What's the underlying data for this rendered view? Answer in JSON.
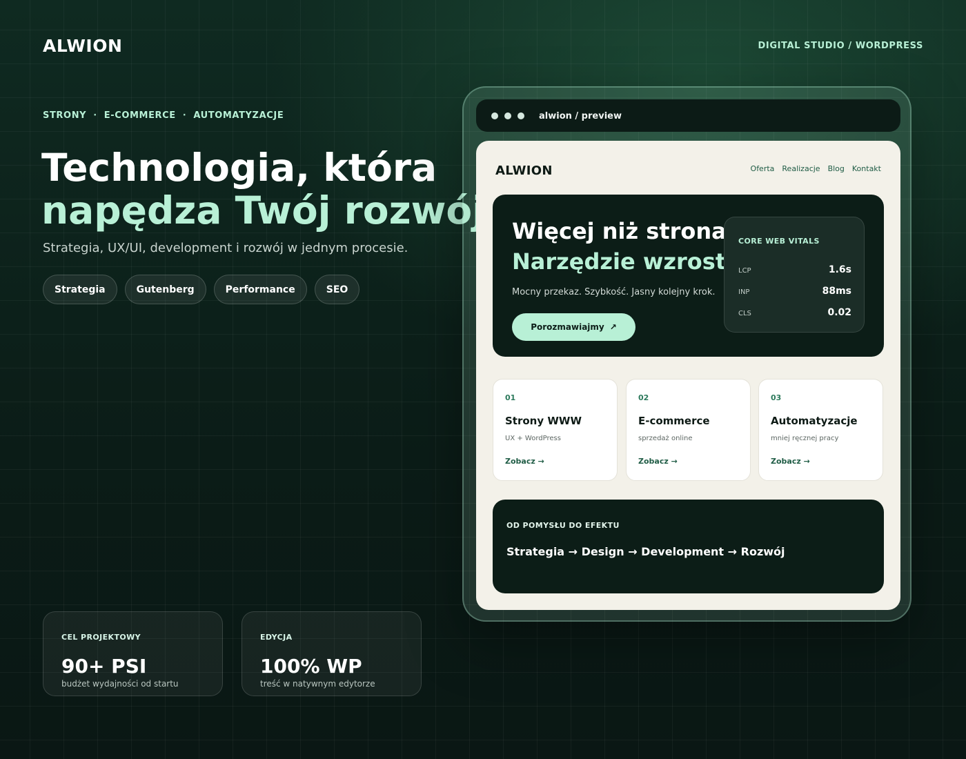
{
  "header": {
    "brand": "ALWION",
    "tagline": "DIGITAL STUDIO / WORDPRESS"
  },
  "services": [
    "STRONY",
    "E-COMMERCE",
    "AUTOMATYZACJE"
  ],
  "services_separator": "·",
  "hero": {
    "title_line1": "Technologia, która",
    "title_line2": "napędza Twój rozwój.",
    "subtitle": "Strategia, UX/UI, development i rozwój w jednym procesie."
  },
  "chips": [
    "Strategia",
    "Gutenberg",
    "Performance",
    "SEO"
  ],
  "stats": [
    {
      "label": "CEL PROJEKTOWY",
      "value": "90+ PSI",
      "desc": "budżet wydajności od startu"
    },
    {
      "label": "EDYCJA",
      "value": "100% WP",
      "desc": "treść w natywnym edytorze"
    }
  ],
  "preview": {
    "window_title": "alwion / preview",
    "brand": "ALWION",
    "nav": [
      "Oferta",
      "Realizacje",
      "Blog",
      "Kontakt"
    ],
    "hero": {
      "title_line1": "Więcej niż strona.",
      "title_line2": "Narzędzie wzrostu.",
      "subtitle": "Mocny przekaz. Szybkość. Jasny kolejny krok.",
      "cta_label": "Porozmawiajmy",
      "cta_icon": "↗"
    },
    "vitals": {
      "title": "CORE WEB VITALS",
      "rows": [
        {
          "key": "LCP",
          "value": "1.6s"
        },
        {
          "key": "INP",
          "value": "88ms"
        },
        {
          "key": "CLS",
          "value": "0.02"
        }
      ]
    },
    "cards": [
      {
        "num": "01",
        "title": "Strony WWW",
        "desc": "UX + WordPress",
        "link": "Zobacz →"
      },
      {
        "num": "02",
        "title": "E-commerce",
        "desc": "sprzedaż online",
        "link": "Zobacz →"
      },
      {
        "num": "03",
        "title": "Automatyzacje",
        "desc": "mniej ręcznej pracy",
        "link": "Zobacz →"
      }
    ],
    "process": {
      "title": "OD POMYSŁU DO EFEKTU",
      "flow": "Strategia → Design → Development → Rozwój"
    }
  },
  "colors": {
    "accent": "#b8f0d6",
    "background": "#0f2a21",
    "panel_dark": "#0c1d17",
    "screen_light": "#f3f1e9"
  }
}
